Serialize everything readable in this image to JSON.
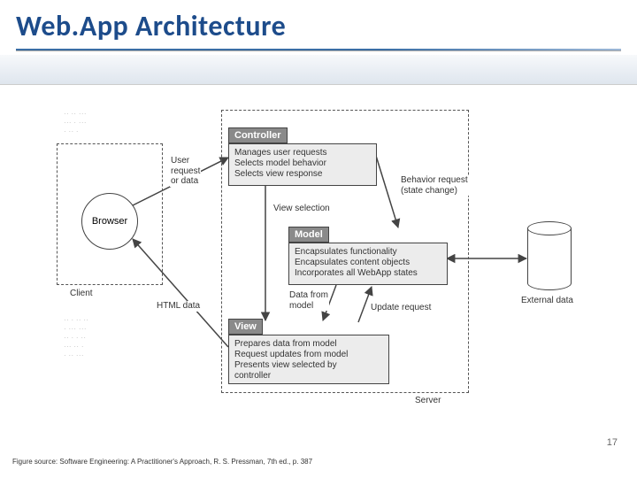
{
  "slide": {
    "title": "Web.App Architecture",
    "page_number": "17",
    "source_line": "Figure source: Software Engineering: A Practitioner's Approach, R. S. Pressman, 7th ed., p. 387"
  },
  "diagram": {
    "client_region_label": "Client",
    "server_region_label": "Server",
    "browser_label": "Browser",
    "external_data_label": "External data",
    "controller": {
      "title": "Controller",
      "line1": "Manages user requests",
      "line2": "Selects model behavior",
      "line3": "Selects view response"
    },
    "model": {
      "title": "Model",
      "line1": "Encapsulates functionality",
      "line2": "Encapsulates content objects",
      "line3": "Incorporates all WebApp states"
    },
    "view": {
      "title": "View",
      "line1": "Prepares data from model",
      "line2": "Request updates from model",
      "line3": "Presents view selected by",
      "line4": "controller"
    },
    "arrows": {
      "user_request": "User\nrequest\nor data",
      "html_data": "HTML data",
      "view_selection": "View selection",
      "behavior_request": "Behavior request\n(state change)",
      "data_from_model": "Data from\nmodel",
      "update_request": "Update request"
    }
  }
}
